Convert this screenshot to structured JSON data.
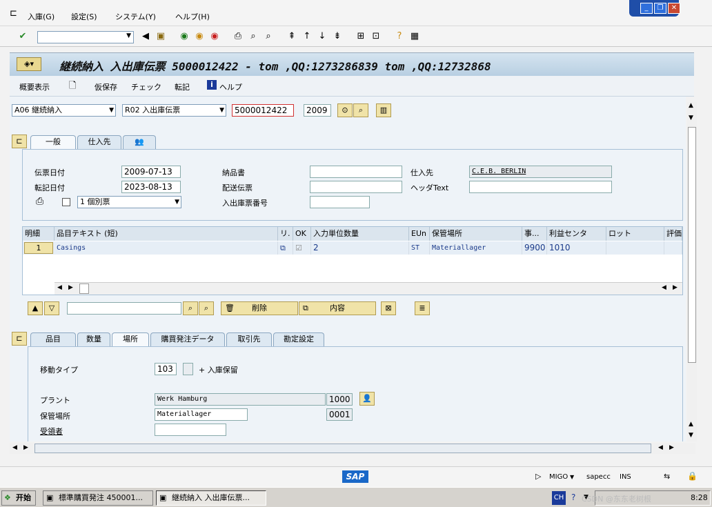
{
  "menu": {
    "items": [
      "入庫(G)",
      "設定(S)",
      "システム(Y)",
      "ヘルプ(H)"
    ]
  },
  "toolbar": {
    "command_value": ""
  },
  "title": "継続納入 入出庫伝票 5000012422 - tom ,QQ:1273286839 tom ,QQ:12732868",
  "app_toolbar": {
    "summary": "概要表示",
    "hold": "仮保存",
    "check": "チェック",
    "post": "転記",
    "help": "ヘルプ"
  },
  "header": {
    "action": "A06 継続納入",
    "document": "R02 入出庫伝票",
    "doc_number": "5000012422",
    "year": "2009"
  },
  "header_tabs": [
    "一般",
    "仕入先"
  ],
  "general": {
    "doc_date_label": "伝票日付",
    "doc_date": "2009-07-13",
    "posting_date_label": "転記日付",
    "posting_date": "2023-08-13",
    "print_option": "1 個別票",
    "delivery_note_label": "納品書",
    "delivery_note": "",
    "bill_of_lading_label": "配送伝票",
    "bill_of_lading": "",
    "gr_slip_label": "入出庫票番号",
    "gr_slip": "",
    "vendor_label": "仕入先",
    "vendor": "C.E.B. BERLIN",
    "header_text_label": "ヘッダText",
    "header_text": ""
  },
  "table": {
    "columns": [
      "明細",
      "品目テキスト (短)",
      "リ.",
      "OK",
      "入力単位数量",
      "EUn",
      "保管場所",
      "事...",
      "利益センタ",
      "ロット",
      "評価"
    ],
    "rows": [
      {
        "line": "1",
        "text": "Casings",
        "ok": "☑",
        "qty": "2",
        "unit": "ST",
        "sloc": "Materiallager",
        "plant": "9900",
        "profit_center": "1010",
        "batch": "",
        "valuation": ""
      }
    ]
  },
  "row_actions": {
    "delete": "削除",
    "contents": "内容",
    "search_value": ""
  },
  "detail_tabs": [
    "品目",
    "数量",
    "場所",
    "購買発注データ",
    "取引先",
    "勘定設定"
  ],
  "detail": {
    "movement_type_label": "移動タイプ",
    "movement_type": "103",
    "gr_blocked": "+ 入庫保留",
    "plant_label": "プラント",
    "plant_name": "Werk Hamburg",
    "plant_code": "1000",
    "sloc_label": "保管場所",
    "sloc_name": "Materiallager",
    "sloc_code": "0001",
    "recipient_label": "受領者",
    "recipient": ""
  },
  "status": {
    "logo": "SAP",
    "transaction": "MIGO",
    "system": "sapecc",
    "mode": "INS"
  },
  "taskbar": {
    "start": "开始",
    "task1": "標準購買発注 450001...",
    "task2": "継続納入 入出庫伝票...",
    "lang": "CH",
    "watermark": "CSDN @东东老树根",
    "clock": "8:28"
  }
}
